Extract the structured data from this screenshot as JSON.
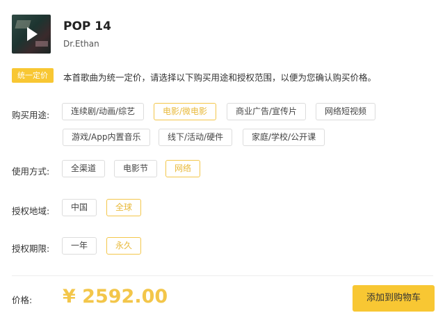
{
  "song": {
    "title": "POP 14",
    "artist": "Dr.Ethan",
    "cover_icon": "play-icon"
  },
  "notice": {
    "badge": "统一定价",
    "text": "本首歌曲为统一定价，请选择以下购买用途和授权范围，以便为您确认购买价格。"
  },
  "purpose": {
    "label": "购买用途:",
    "options": [
      "连续剧/动画/综艺",
      "电影/微电影",
      "商业广告/宣传片",
      "网络短视频",
      "游戏/App内置音乐",
      "线下/活动/硬件",
      "家庭/学校/公开课"
    ],
    "selected": "电影/微电影"
  },
  "usage": {
    "label": "使用方式:",
    "options": [
      "全渠道",
      "电影节",
      "网络"
    ],
    "selected": "网络"
  },
  "region": {
    "label": "授权地域:",
    "options": [
      "中国",
      "全球"
    ],
    "selected": "全球"
  },
  "period": {
    "label": "授权期限:",
    "options": [
      "一年",
      "永久"
    ],
    "selected": "永久"
  },
  "price": {
    "label": "价格:",
    "value": "¥ 2592.00"
  },
  "cart_button": "添加到购物车",
  "colors": {
    "accent": "#f8c733",
    "selected_text": "#e8b93a",
    "border": "#dcdcdc"
  }
}
